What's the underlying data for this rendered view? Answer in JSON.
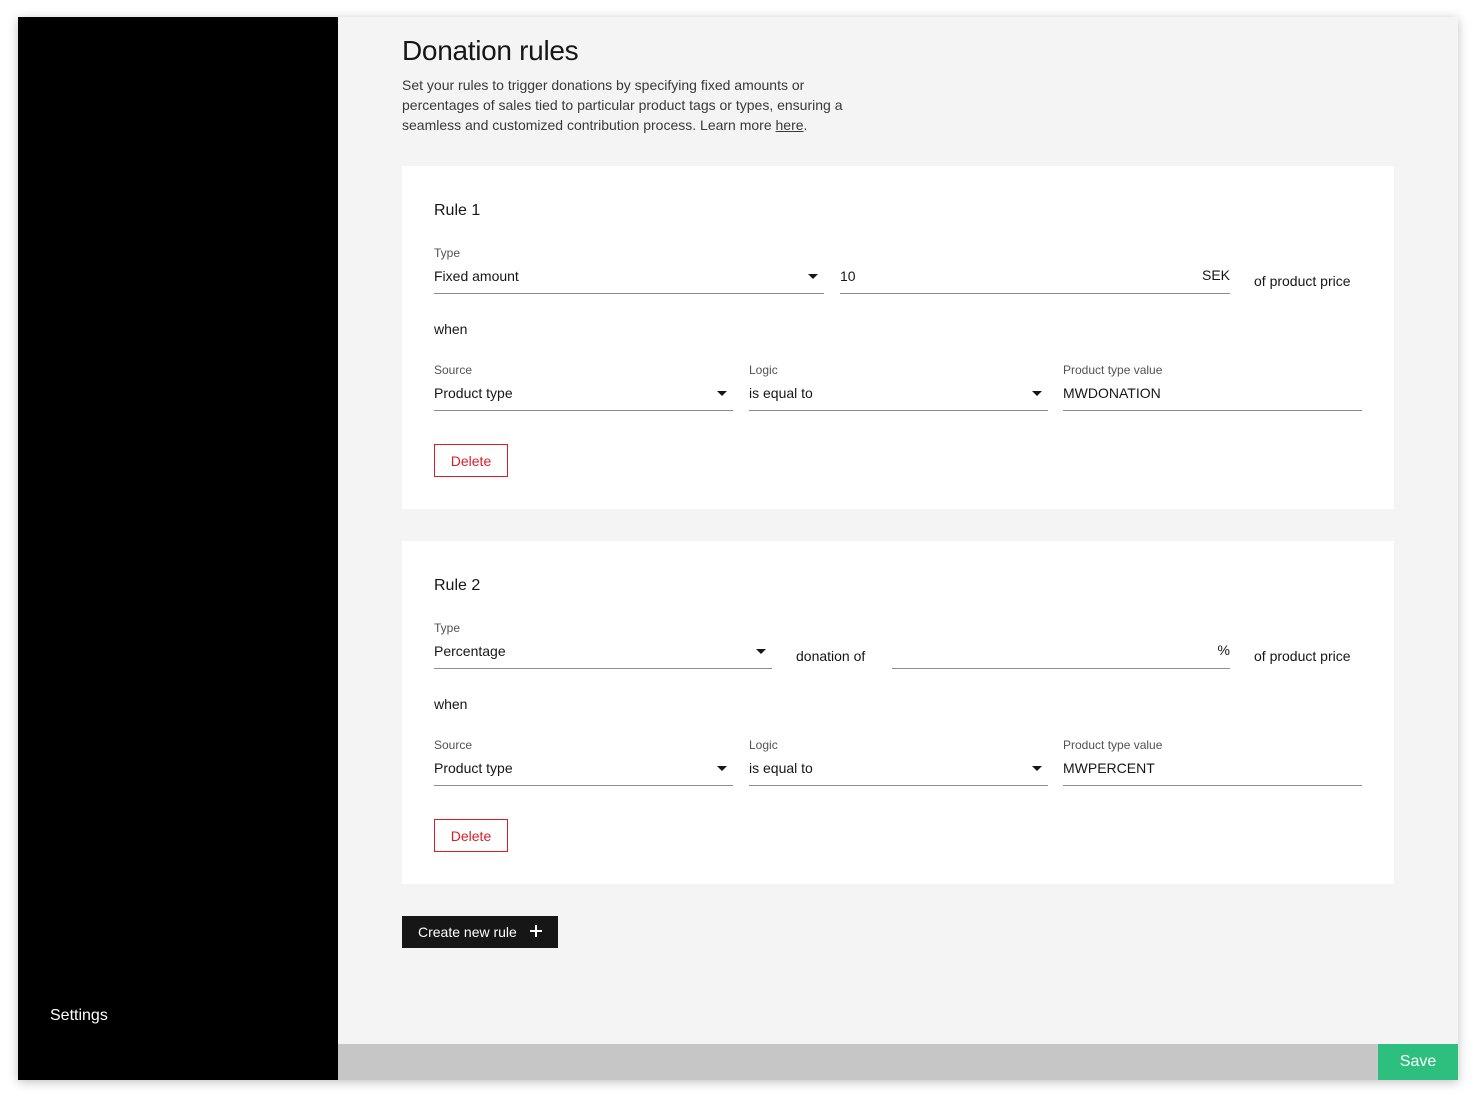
{
  "sidebar": {
    "settings_label": "Settings"
  },
  "page": {
    "title": "Donation rules",
    "description": "Set your rules to trigger donations by specifying fixed amounts or percentages of sales tied to particular product tags or types, ensuring a seamless and customized contribution process.  Learn more ",
    "link_text": "here",
    "desc_end": "."
  },
  "rules": [
    {
      "title": "Rule 1",
      "type_label": "Type",
      "type_value": "Fixed amount",
      "amount_value": "10",
      "amount_suffix": "SEK",
      "tail_text": "of product price",
      "when_text": "when",
      "source_label": "Source",
      "source_value": "Product type",
      "logic_label": "Logic",
      "logic_value": "is equal to",
      "value_label": "Product type value",
      "value_value": "MWDONATION",
      "delete_label": "Delete"
    },
    {
      "title": "Rule 2",
      "type_label": "Type",
      "type_value": "Percentage",
      "middle_text": "donation of",
      "amount_value": "",
      "amount_suffix": "%",
      "tail_text": "of product price",
      "when_text": "when",
      "source_label": "Source",
      "source_value": "Product type",
      "logic_label": "Logic",
      "logic_value": "is equal to",
      "value_label": "Product type value",
      "value_value": "MWPERCENT",
      "delete_label": "Delete"
    }
  ],
  "actions": {
    "create_label": "Create new rule",
    "save_label": "Save"
  },
  "colors": {
    "danger": "#da1e28",
    "save": "#2dbf7e",
    "sidebar": "#000000"
  }
}
